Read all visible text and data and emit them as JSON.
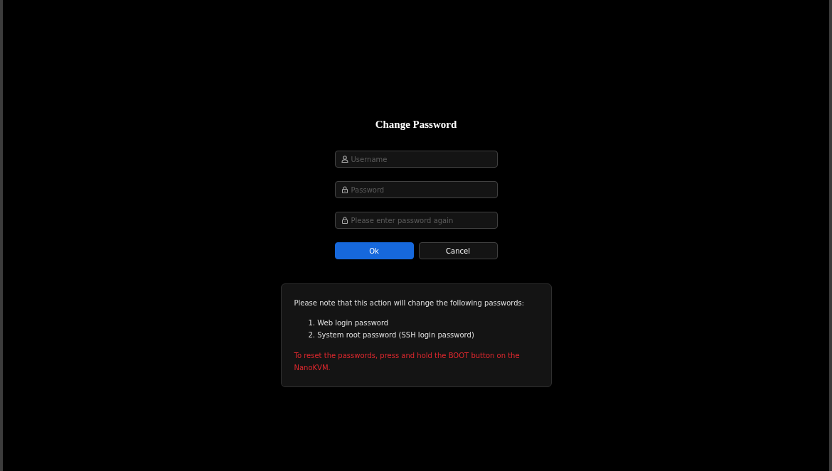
{
  "title": "Change Password",
  "fields": [
    {
      "kind": "user",
      "placeholder": "Username"
    },
    {
      "kind": "lock",
      "placeholder": "Password"
    },
    {
      "kind": "lock",
      "placeholder": "Please enter password again"
    }
  ],
  "buttons": [
    {
      "label": "Ok",
      "kind": "primary"
    },
    {
      "label": "Cancel",
      "kind": "default"
    }
  ],
  "note": {
    "intro": "Please note that this action will change the following passwords:",
    "items": [
      "1. Web login password",
      "2. System root password (SSH login password)"
    ],
    "warning": "To reset the passwords, press and hold the BOOT button on the NanoKVM."
  }
}
